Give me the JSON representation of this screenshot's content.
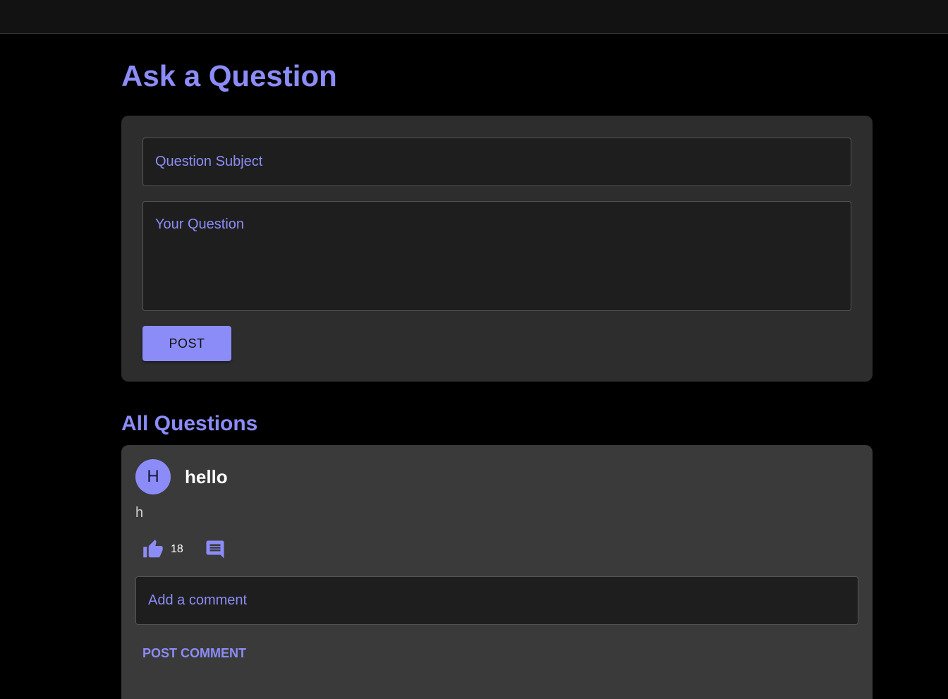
{
  "ask": {
    "title": "Ask a Question",
    "subject_placeholder": "Question Subject",
    "question_placeholder": "Your Question",
    "post_label": "POST"
  },
  "questions_section": {
    "title": "All Questions",
    "items": [
      {
        "avatar_letter": "H",
        "title": "hello",
        "body": "h",
        "like_count": "18",
        "comment_placeholder": "Add a comment",
        "post_comment_label": "POST COMMENT"
      }
    ]
  },
  "icons": {
    "like": "thumb-up-icon",
    "comment": "comment-icon"
  },
  "colors": {
    "accent": "#8c8cf8",
    "background": "#000000",
    "topbar": "#121212",
    "card": "#2d2d2d",
    "question_card": "#3a3a3a",
    "field": "#1e1e1e"
  }
}
